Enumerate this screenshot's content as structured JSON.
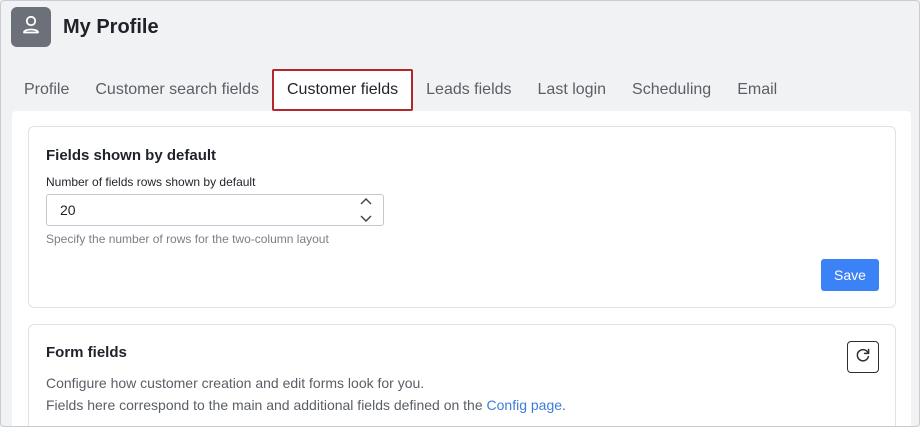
{
  "header": {
    "title": "My Profile",
    "avatar_icon": "user-icon"
  },
  "tabs": [
    {
      "label": "Profile",
      "active": false
    },
    {
      "label": "Customer search fields",
      "active": false
    },
    {
      "label": "Customer fields",
      "active": true
    },
    {
      "label": "Leads fields",
      "active": false
    },
    {
      "label": "Last login",
      "active": false
    },
    {
      "label": "Scheduling",
      "active": false
    },
    {
      "label": "Email",
      "active": false
    }
  ],
  "fields_default": {
    "title": "Fields shown by default",
    "label": "Number of fields rows shown by default",
    "value": "20",
    "helper": "Specify the number of rows for the two-column layout",
    "save_label": "Save"
  },
  "form_fields": {
    "title": "Form fields",
    "line1": "Configure how customer creation and edit forms look for you.",
    "line2_prefix": "Fields here correspond to the main and additional fields defined on the ",
    "line2_link": "Config page",
    "line2_suffix": "."
  },
  "colors": {
    "accent": "#3b82f6",
    "active_tab_border": "#b3262b",
    "link": "#3b7ddd"
  }
}
